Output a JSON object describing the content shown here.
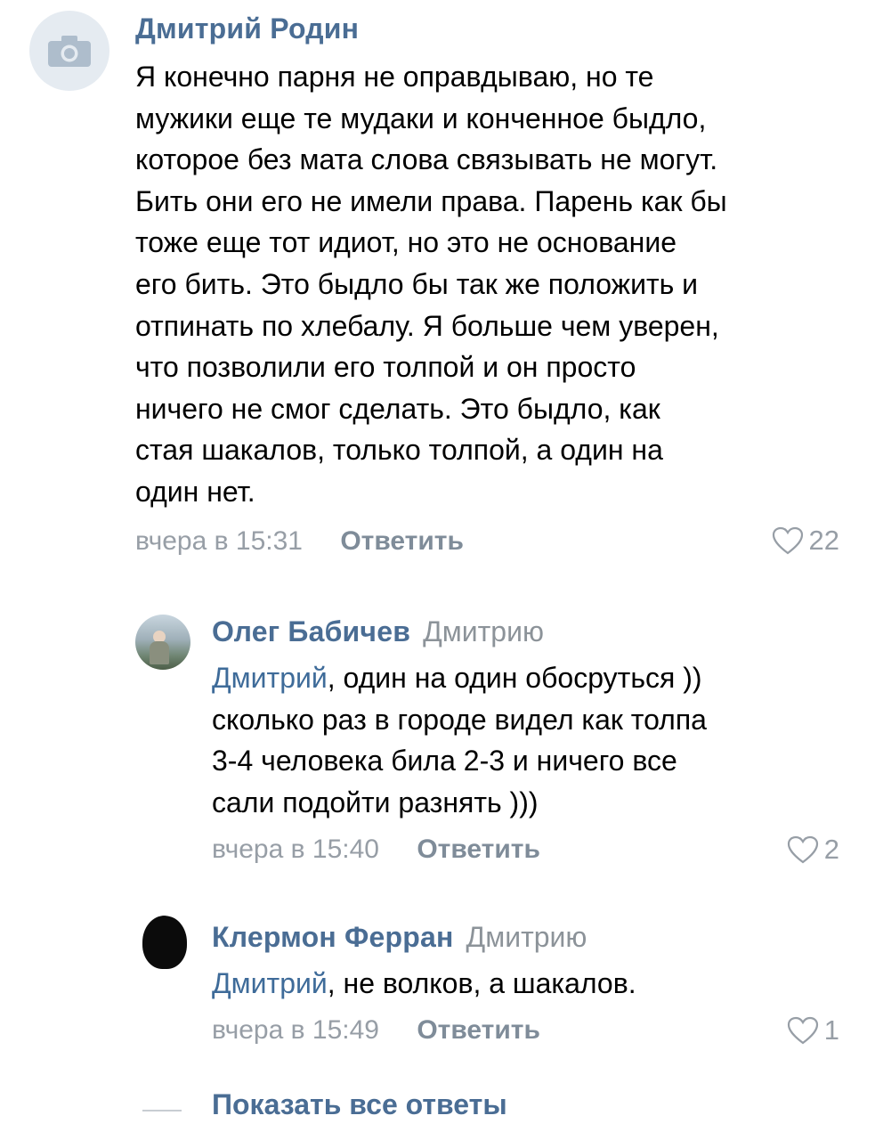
{
  "comments": [
    {
      "author": "Дмитрий Родин",
      "reply_to": "",
      "mention": "",
      "lines": [
        "Я конечно парня не оправдываю, но те",
        "мужики еще те мудаки и конченное быдло,",
        "которое без мата слова связывать не могут.",
        "Бить они его не имели права. Парень как бы",
        "тоже еще тот идиот, но это не основание",
        "его бить. Это быдло бы так же положить и",
        "отпинать по хлебалу. Я больше чем уверен,",
        "что позволили его толпой и он просто",
        "ничего не смог сделать. Это быдло, как",
        "стая шакалов, только толпой, а один на",
        "один нет."
      ],
      "time": "вчера в 15:31",
      "reply_label": "Ответить",
      "likes": "22"
    },
    {
      "author": "Олег Бабичев",
      "reply_to": "Дмитрию",
      "mention": "Дмитрий",
      "first_line_rest": ", один на один обосруться ))",
      "lines": [
        "сколько раз в городе видел как толпа",
        "3-4 человека била 2-3 и ничего все",
        "сали подойти разнять )))"
      ],
      "time": "вчера в 15:40",
      "reply_label": "Ответить",
      "likes": "2"
    },
    {
      "author": "Клермон Ферран",
      "reply_to": "Дмитрию",
      "mention": "Дмитрий",
      "first_line_rest": ", не волков, а шакалов.",
      "lines": [],
      "time": "вчера в 15:49",
      "reply_label": "Ответить",
      "likes": "1"
    }
  ],
  "show_all_label": "Показать все ответы",
  "icons": {
    "camera": "camera-icon",
    "heart": "heart-outline-icon"
  },
  "colors": {
    "author": "#4a6d94",
    "mention": "#3e6b99",
    "meta": "#979ea6"
  }
}
